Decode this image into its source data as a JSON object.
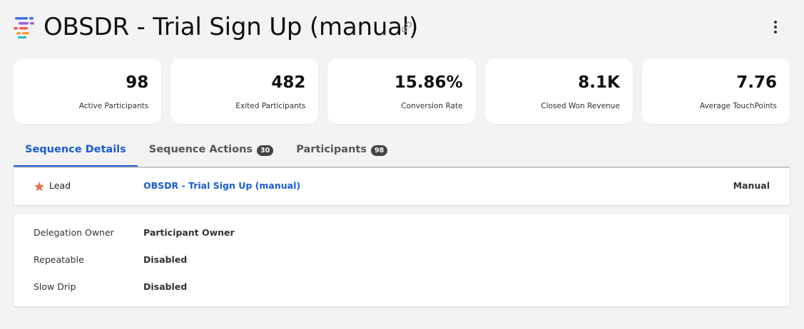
{
  "header": {
    "title": "OBSDR - Trial Sign Up (manual)"
  },
  "stats": [
    {
      "value": "98",
      "label": "Active Participants"
    },
    {
      "value": "482",
      "label": "Exited Participants"
    },
    {
      "value": "15.86%",
      "label": "Conversion Rate"
    },
    {
      "value": "8.1K",
      "label": "Closed Won Revenue"
    },
    {
      "value": "7.76",
      "label": "Average TouchPoints"
    }
  ],
  "tabs": [
    {
      "label": "Sequence Details"
    },
    {
      "label": "Sequence Actions",
      "badge": "30"
    },
    {
      "label": "Participants",
      "badge": "98"
    }
  ],
  "lead": {
    "type": "Lead",
    "name": "OBSDR - Trial Sign Up (manual)",
    "mode": "Manual"
  },
  "details": [
    {
      "label": "Delegation Owner",
      "value": "Participant Owner"
    },
    {
      "label": "Repeatable",
      "value": "Disabled"
    },
    {
      "label": "Slow Drip",
      "value": "Disabled"
    }
  ],
  "colors": {
    "accent": "#1a5bd6",
    "background": "#f3f3f3",
    "star": "#e8734a"
  },
  "icons": {
    "logo": "sequence-logo-icon",
    "link": "link-icon",
    "more": "more-vertical-icon",
    "lead": "star-icon"
  }
}
